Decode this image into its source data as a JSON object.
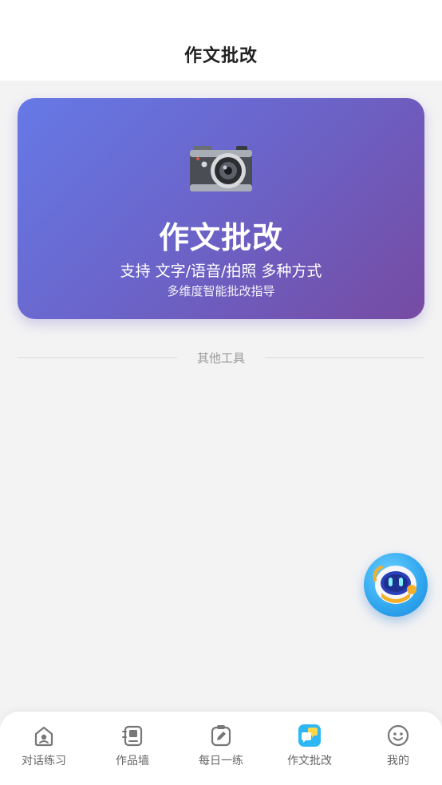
{
  "header": {
    "title": "作文批改"
  },
  "hero": {
    "icon": "camera-icon",
    "title": "作文批改",
    "subtitle": "支持 文字/语音/拍照 多种方式",
    "description": "多维度智能批改指导"
  },
  "section": {
    "other_tools_label": "其他工具"
  },
  "fab": {
    "icon": "robot-assistant-icon"
  },
  "tabbar": {
    "items": [
      {
        "label": "对话练习",
        "icon": "home-chat-icon",
        "active": false
      },
      {
        "label": "作品墙",
        "icon": "gallery-book-icon",
        "active": false
      },
      {
        "label": "每日一练",
        "icon": "pencil-card-icon",
        "active": false
      },
      {
        "label": "作文批改",
        "icon": "chat-bubbles-icon",
        "active": true
      },
      {
        "label": "我的",
        "icon": "smiley-face-icon",
        "active": false
      }
    ]
  },
  "colors": {
    "hero_gradient_start": "#6679e6",
    "hero_gradient_end": "#764ba2",
    "active_tab": "#2db7f5"
  }
}
